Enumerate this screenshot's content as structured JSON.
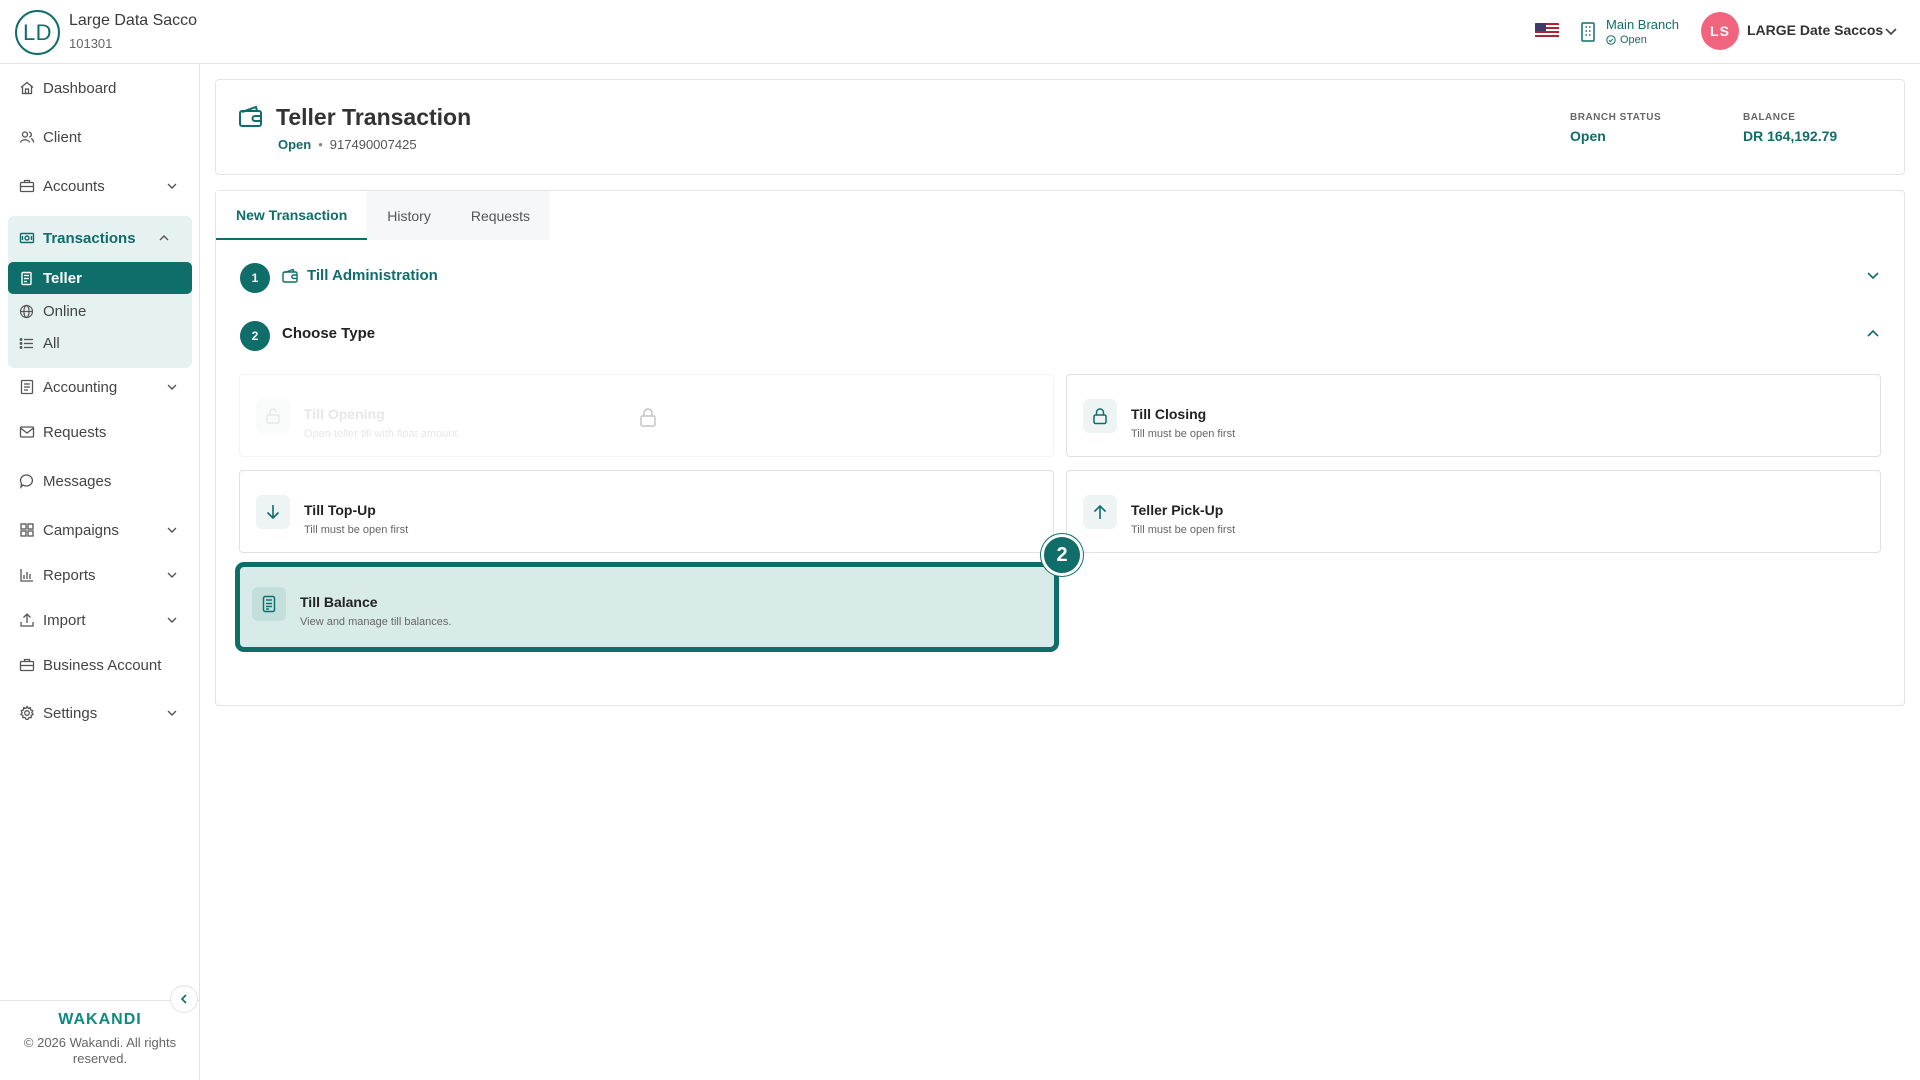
{
  "org": {
    "initials": "LD",
    "name": "Large Data Sacco",
    "code": "101301"
  },
  "header": {
    "branch_name": "Main Branch",
    "branch_status": "Open",
    "user_initials": "LS",
    "user_name": "LARGE Date Saccos"
  },
  "colors": {
    "primary": "#0f6d6a",
    "avatar": "#f0647e",
    "selected_bg": "#d8ebe9"
  },
  "sidebar": {
    "items": [
      {
        "label": "Dashboard",
        "icon": "home-icon"
      },
      {
        "label": "Client",
        "icon": "users-icon"
      },
      {
        "label": "Accounts",
        "icon": "briefcase-icon"
      },
      {
        "label": "Transactions",
        "icon": "cash-icon"
      },
      {
        "label": "Accounting",
        "icon": "ledger-icon"
      },
      {
        "label": "Requests",
        "icon": "mail-icon"
      },
      {
        "label": "Messages",
        "icon": "chat-icon"
      },
      {
        "label": "Campaigns",
        "icon": "grid-icon"
      },
      {
        "label": "Reports",
        "icon": "bar-chart-icon"
      },
      {
        "label": "Import",
        "icon": "upload-icon"
      },
      {
        "label": "Business Account",
        "icon": "briefcase-icon"
      },
      {
        "label": "Settings",
        "icon": "gear-icon"
      }
    ],
    "sub_items": [
      {
        "label": "Teller",
        "icon": "receipt-icon"
      },
      {
        "label": "Online",
        "icon": "globe-icon"
      },
      {
        "label": "All",
        "icon": "list-icon"
      }
    ],
    "brand": "WAKANDI",
    "copyright": "© 2026 Wakandi. All rights reserved."
  },
  "page": {
    "title": "Teller Transaction",
    "status": "Open",
    "separator": "•",
    "account_number": "917490007425",
    "branch_status_label": "BRANCH STATUS",
    "branch_status_value": "Open",
    "balance_label": "BALANCE",
    "balance_value": "DR 164,192.79"
  },
  "tabs": [
    {
      "label": "New Transaction"
    },
    {
      "label": "History"
    },
    {
      "label": "Requests"
    }
  ],
  "steps": [
    {
      "number": "1",
      "label": "Till Administration"
    },
    {
      "number": "2",
      "label": "Choose Type"
    }
  ],
  "options": [
    {
      "title": "Till Opening",
      "desc": "Open teller till with float amount",
      "icon": "open-till-icon",
      "state": "disabled"
    },
    {
      "title": "Till Closing",
      "desc": "Till must be open first",
      "icon": "lock-icon",
      "state": "normal"
    },
    {
      "title": "Till Top-Up",
      "desc": "Till must be open first",
      "icon": "arrow-down-icon",
      "state": "normal"
    },
    {
      "title": "Teller Pick-Up",
      "desc": "Till must be open first",
      "icon": "arrow-up-icon",
      "state": "normal"
    },
    {
      "title": "Till Balance",
      "desc": "View and manage till balances.",
      "icon": "calculator-icon",
      "state": "selected"
    }
  ],
  "annotation_badge": "2"
}
